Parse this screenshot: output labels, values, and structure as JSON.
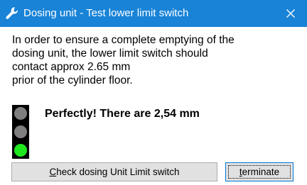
{
  "window": {
    "title": "Dosing unit  -  Test lower limit switch",
    "titlebar_color": "#1883d7",
    "title_icon": "wrench-icon",
    "close_icon": "close-icon"
  },
  "message": {
    "lines": [
      "In order to ensure a complete emptying of the",
      "dosing unit, the lower limit switch should",
      "contact approx 2.65 mm",
      "prior of the cylinder floor."
    ]
  },
  "status": {
    "traffic_light": {
      "red": "off",
      "yellow": "off",
      "green": "on"
    },
    "result_text": "Perfectly! There are 2,54 mm"
  },
  "buttons": {
    "check_label": "Check dosing Unit Limit switch",
    "terminate_label": "terminate"
  }
}
